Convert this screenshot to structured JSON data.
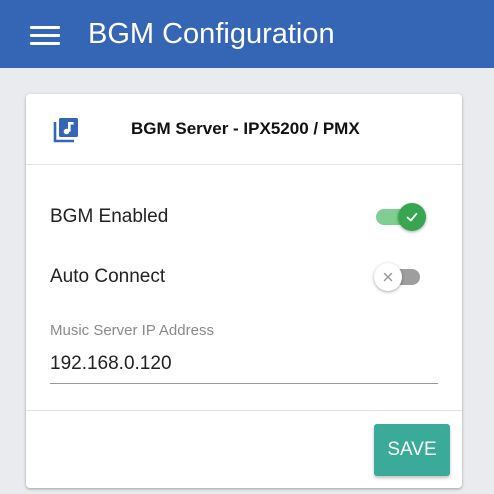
{
  "appbar": {
    "menu_icon": "hamburger-menu-icon",
    "title": "BGM Configuration",
    "background": "#3565b5"
  },
  "card": {
    "header": {
      "icon": "music-library-icon",
      "icon_color": "#3565b5",
      "title": "BGM Server - IPX5200 / PMX"
    },
    "settings": [
      {
        "label": "BGM Enabled",
        "enabled": true,
        "state_icon": "check-icon"
      },
      {
        "label": "Auto Connect",
        "enabled": false,
        "state_icon": "close-icon"
      }
    ],
    "ip_field": {
      "label": "Music Server IP Address",
      "value": "192.168.0.120"
    },
    "save_button": {
      "label": "SAVE",
      "color": "#3aaa99"
    }
  },
  "colors": {
    "toggle_on_thumb": "#38a651",
    "toggle_on_track": "#7fcf92",
    "toggle_off_track": "#9e9e9e",
    "page_background": "#e9ebee"
  }
}
